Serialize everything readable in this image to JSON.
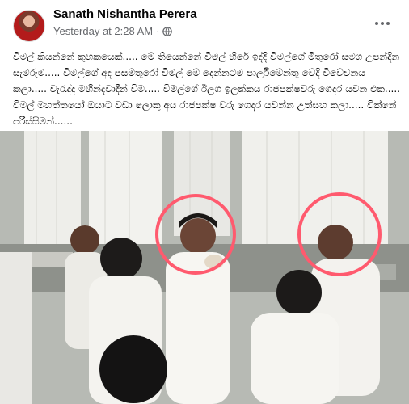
{
  "post": {
    "author": "Sanath Nishantha Perera",
    "timestamp": "Yesterday at 2:28 AM",
    "separator": "·",
    "privacy_icon": "globe-icon",
    "more_icon": "more-horizontal-icon",
    "text": "විමල් කියන්නේ කුහකයෙක්..... මේ තියෙන්නේ විමල් හිරේ ඉද්දි විමල්ගේ මිතුරෝ සමග උපන්දින සැමරුම..... විමල්ගේ අද පසම්තුරෝ විමල් මේ දෙන්නටම පාර්ලිමේන්තු වේදි විවේචනය කලා..... වැරැද්ද මහින්දවාදීන් විම..... විමල්ගේ ඊලග ඉලක්කය රාජපක්ෂවරු ගෙදර යවන එක..... විමල් මහත්තයෝ ඔයාට වඩා ලොකු අය රාජපක්ෂ වරු ගෙදර යවන්න උත්සහ කලා..... වික්නේ පරිස්සිමන්......"
  },
  "colors": {
    "author": "#050505",
    "meta": "#65676b",
    "circle_annotation": "#ff5a6e"
  },
  "photo": {
    "description_icon": "photo-image"
  }
}
